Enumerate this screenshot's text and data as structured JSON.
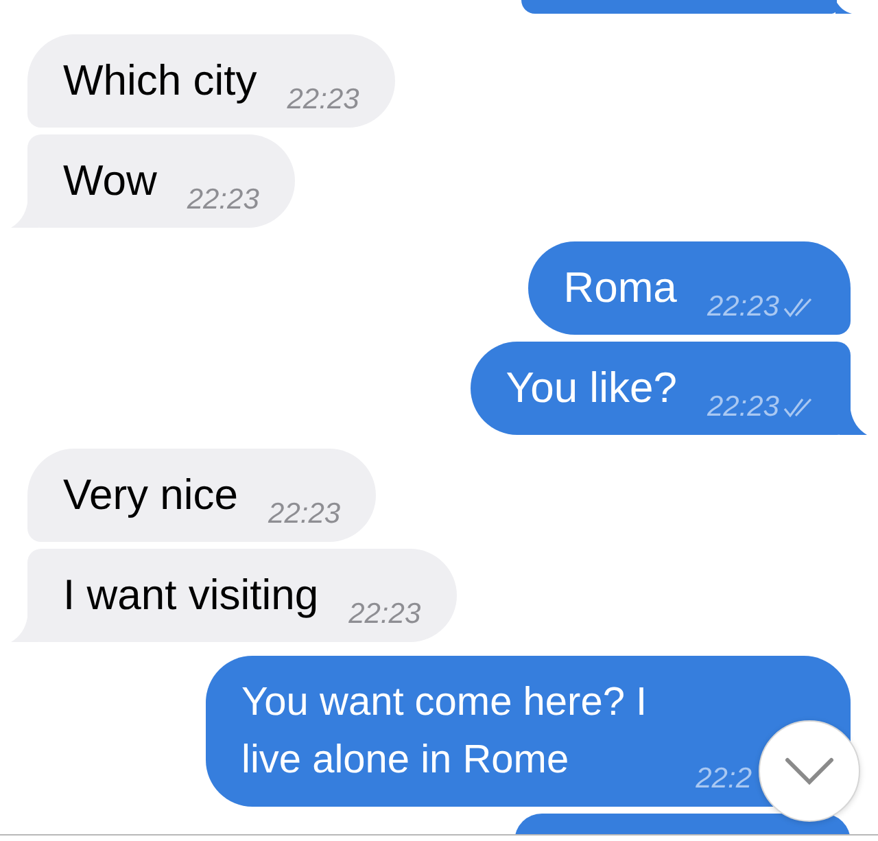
{
  "messages": [
    {
      "kind": "fragment",
      "outgoing": true,
      "tail": true
    },
    {
      "kind": "text",
      "outgoing": false,
      "text": "Which city",
      "time": "22:23",
      "tail": false
    },
    {
      "kind": "text",
      "outgoing": false,
      "text": "Wow",
      "time": "22:23",
      "tail": true
    },
    {
      "kind": "text",
      "outgoing": true,
      "text": "Roma",
      "time": "22:23",
      "read": true,
      "tail": false
    },
    {
      "kind": "text",
      "outgoing": true,
      "text": "You like?",
      "time": "22:23",
      "read": true,
      "tail": true
    },
    {
      "kind": "text",
      "outgoing": false,
      "text": "Very nice",
      "time": "22:23",
      "tail": false
    },
    {
      "kind": "text",
      "outgoing": false,
      "text": "I want visiting",
      "time": "22:23",
      "tail": true
    },
    {
      "kind": "text",
      "outgoing": true,
      "text": "You want come here? I live alone in Rome",
      "time": "22:2",
      "tail": false
    },
    {
      "kind": "fragment",
      "outgoing": true,
      "tail": false
    }
  ],
  "scroll_down_button": {
    "visible": true
  }
}
